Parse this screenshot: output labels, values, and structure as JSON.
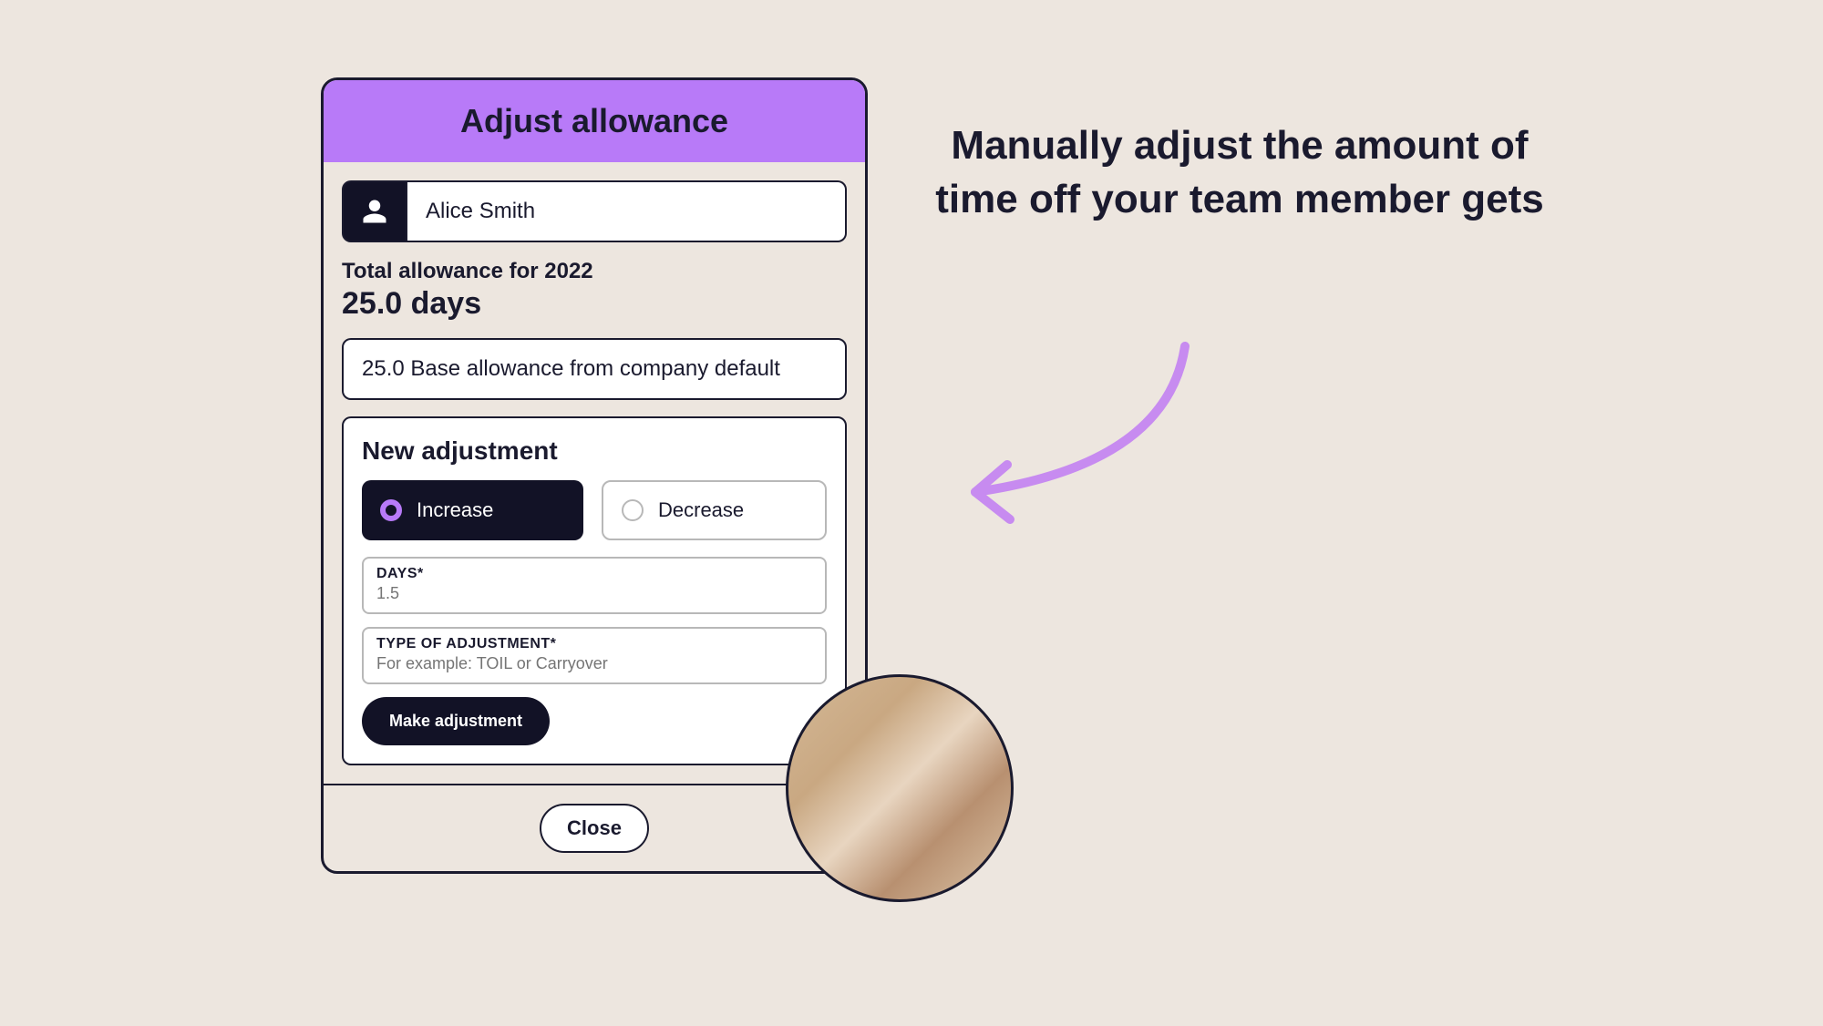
{
  "card": {
    "title": "Adjust allowance",
    "user_name": "Alice Smith",
    "allowance_label": "Total allowance for 2022",
    "allowance_value": "25.0 days",
    "base_allowance": "25.0 Base allowance from company default",
    "adjustment": {
      "title": "New adjustment",
      "increase_label": "Increase",
      "decrease_label": "Decrease",
      "days_label": "DAYS*",
      "days_placeholder": "1.5",
      "type_label": "TYPE OF ADJUSTMENT*",
      "type_placeholder": "For example: TOIL or Carryover",
      "submit_label": "Make adjustment"
    },
    "close_label": "Close"
  },
  "annotation": "Manually adjust the amount of time off your team member gets",
  "colors": {
    "accent": "#b87af8",
    "dark": "#121226"
  }
}
